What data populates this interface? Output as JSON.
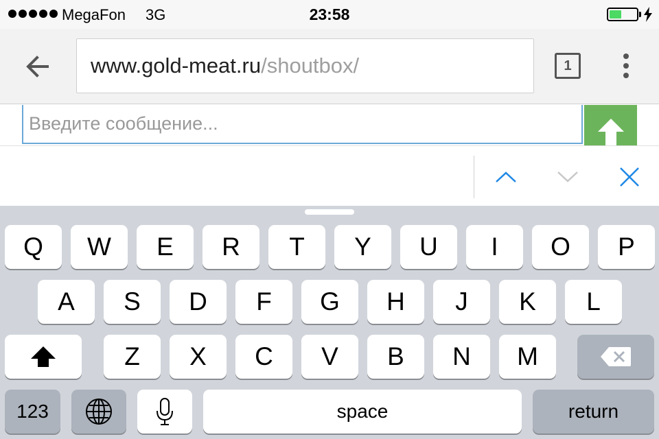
{
  "status": {
    "carrier": "MegaFon",
    "network": "3G",
    "time": "23:58",
    "battery_level": 0.45
  },
  "browser": {
    "url_host": "www.gold-meat.ru",
    "url_path": "/shoutbox/",
    "tab_count": "1",
    "icons": [
      "back-arrow-icon",
      "tabs-icon",
      "overflow-menu-icon"
    ]
  },
  "page": {
    "message_placeholder": "Введите сообщение...",
    "send_icon": "arrow-up-icon",
    "accent_color": "#6cb45b"
  },
  "find_bar": {
    "icons": [
      "chevron-up-icon",
      "chevron-down-icon",
      "close-icon"
    ],
    "accent_color": "#1e88e5"
  },
  "keyboard": {
    "row1": [
      "Q",
      "W",
      "E",
      "R",
      "T",
      "Y",
      "U",
      "I",
      "O",
      "P"
    ],
    "row2": [
      "A",
      "S",
      "D",
      "F",
      "G",
      "H",
      "J",
      "K",
      "L"
    ],
    "row3": [
      "Z",
      "X",
      "C",
      "V",
      "B",
      "N",
      "M"
    ],
    "numbers_label": "123",
    "space_label": "space",
    "return_label": "return"
  }
}
